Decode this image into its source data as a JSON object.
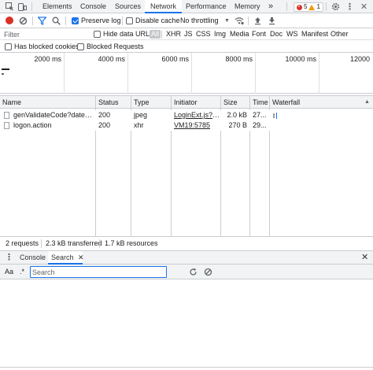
{
  "tabs": [
    {
      "label": "Elements"
    },
    {
      "label": "Console"
    },
    {
      "label": "Sources"
    },
    {
      "label": "Network"
    },
    {
      "label": "Performance"
    },
    {
      "label": "Memory"
    }
  ],
  "more_tabs_glyph": "»",
  "errors": {
    "count": "5",
    "color": "#d93025"
  },
  "warnings": {
    "count": "1",
    "color": "#f29900"
  },
  "toolbar": {
    "preserve_log": {
      "label": "Preserve log",
      "checked": true
    },
    "disable_cache": {
      "label": "Disable cache",
      "checked": false
    },
    "throttling": {
      "value": "No throttling"
    }
  },
  "filter": {
    "placeholder": "Filter",
    "value": "",
    "hide_data_urls": {
      "label": "Hide data URLs",
      "checked": false
    },
    "types": [
      "All",
      "XHR",
      "JS",
      "CSS",
      "Img",
      "Media",
      "Font",
      "Doc",
      "WS",
      "Manifest",
      "Other"
    ],
    "active_type": "All"
  },
  "blocked": {
    "has_blocked_cookies": {
      "label": "Has blocked cookies",
      "checked": false
    },
    "blocked_requests": {
      "label": "Blocked Requests",
      "checked": false
    }
  },
  "overview": {
    "tick_labels": [
      "2000 ms",
      "4000 ms",
      "6000 ms",
      "8000 ms",
      "10000 ms",
      "12000"
    ]
  },
  "table": {
    "columns": [
      "Name",
      "Status",
      "Type",
      "Initiator",
      "Size",
      "Time",
      "Waterfall"
    ],
    "rows": [
      {
        "name": "genValidateCode?dateTim...",
        "status": "200",
        "type": "jpeg",
        "initiator": "LoginExt.js?v...",
        "size": "2.0 kB",
        "time": "27..."
      },
      {
        "name": "logon.action",
        "status": "200",
        "type": "xhr",
        "initiator": "VM19:5785",
        "size": "270 B",
        "time": "29..."
      }
    ]
  },
  "status": {
    "requests": "2 requests",
    "transferred": "2.3 kB transferred",
    "resources": "1.7 kB resources"
  },
  "drawer": {
    "tabs": [
      {
        "label": "Console"
      },
      {
        "label": "Search"
      }
    ],
    "active": "Search",
    "search": {
      "case_label": "Aa",
      "regex_label": ".*",
      "placeholder": "Search",
      "value": ""
    }
  },
  "colors": {
    "accent": "#1a73e8",
    "record": "#d93025",
    "panel_bg": "#f1f3f4"
  }
}
